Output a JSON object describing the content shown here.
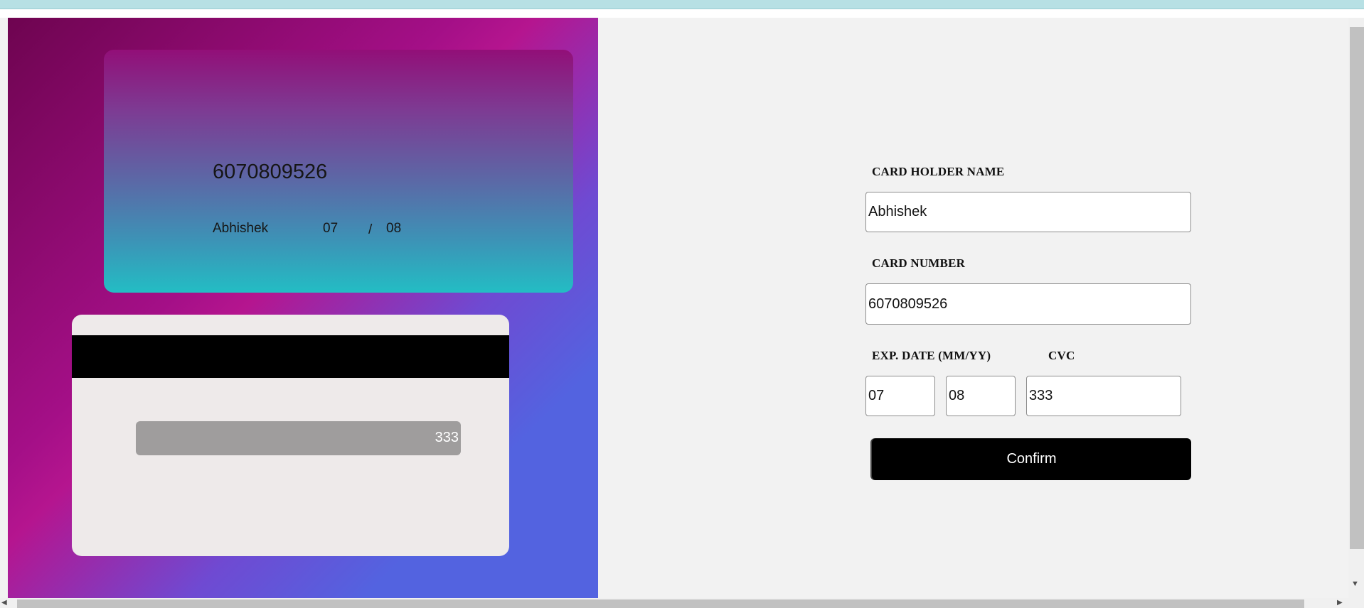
{
  "card_preview": {
    "front": {
      "number": "6070809526",
      "holder_name": "Abhishek",
      "exp_month": "07",
      "separator": "/",
      "exp_year": "08"
    },
    "back": {
      "cvc": "333"
    }
  },
  "form": {
    "holder_label": "CARD HOLDER NAME",
    "holder_value": "Abhishek",
    "number_label": "CARD NUMBER",
    "number_value": "6070809526",
    "exp_label": "EXP. DATE (MM/YY)",
    "exp_month_value": "07",
    "exp_year_value": "08",
    "cvc_label": "CVC",
    "cvc_value": "333",
    "confirm_label": "Confirm"
  },
  "colors": {
    "topbar": "#b7e0e4",
    "form_background": "#f2f2f2",
    "confirm_button": "#000000",
    "gradient": [
      "#6e0450",
      "#b5158f",
      "#5363e0"
    ],
    "card_front_gradient": [
      "#920f78",
      "#23bdc4"
    ],
    "card_back": "#eeeaea",
    "cvc_strip": "#9f9d9d"
  }
}
